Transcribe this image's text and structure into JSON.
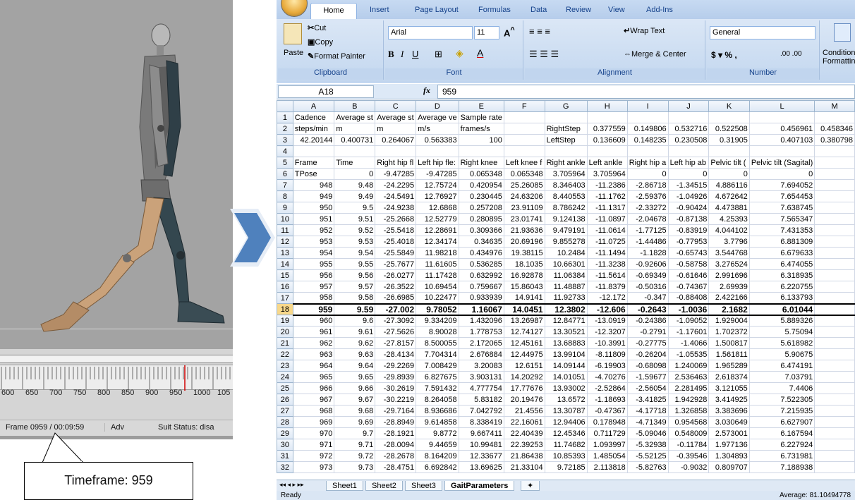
{
  "mocap": {
    "ruler_labels": [
      "600",
      "650",
      "700",
      "750",
      "800",
      "850",
      "900",
      "950",
      "1000",
      "105"
    ],
    "status_frame": "Frame 0959 / 00:09:59",
    "status_mode": "Adv",
    "status_suit": "Suit Status: disa",
    "callout": "Timeframe: 959",
    "current_frame": 959,
    "colors": {
      "body": "#caa27a",
      "dark": "#34474f",
      "grey": "#6f6f6f"
    }
  },
  "excel": {
    "tabs": [
      "Home",
      "Insert",
      "Page Layout",
      "Formulas",
      "Data",
      "Review",
      "View",
      "Add-Ins"
    ],
    "ribbon": {
      "clipboard": {
        "label": "Clipboard",
        "paste": "Paste",
        "cut": "Cut",
        "copy": "Copy",
        "format_painter": "Format Painter"
      },
      "font": {
        "label": "Font",
        "name": "Arial",
        "size": "11"
      },
      "alignment": {
        "label": "Alignment",
        "wrap": "Wrap Text",
        "merge": "Merge & Center"
      },
      "number": {
        "label": "Number",
        "format": "General"
      },
      "styles": {
        "conditional": "Conditional",
        "formatting": "Formatting"
      }
    },
    "name_box": "A18",
    "fx": "fx",
    "formula_value": "959",
    "columns": [
      "A",
      "B",
      "C",
      "D",
      "E",
      "F",
      "G",
      "H",
      "I",
      "J",
      "K",
      "L",
      "M"
    ],
    "rows": [
      {
        "n": "1",
        "c": [
          "Cadence",
          "Average st",
          "Average st",
          "Average ve",
          "Sample rate",
          "",
          "",
          "",
          "",
          "",
          "",
          "",
          ""
        ]
      },
      {
        "n": "2",
        "c": [
          "steps/min",
          "m",
          "m",
          "m/s",
          "frames/s",
          "",
          "RightStep",
          "0.377559",
          "0.149806",
          "0.532716",
          "0.522508",
          "0.456961",
          "0.458346"
        ]
      },
      {
        "n": "3",
        "c": [
          "42.20144",
          "0.400731",
          "0.264067",
          "0.563383",
          "100",
          "",
          "LeftStep",
          "0.136609",
          "0.148235",
          "0.230508",
          "0.31905",
          "0.407103",
          "0.380798"
        ]
      },
      {
        "n": "4",
        "c": [
          "",
          "",
          "",
          "",
          "",
          "",
          "",
          "",
          "",
          "",
          "",
          "",
          ""
        ]
      },
      {
        "n": "5",
        "c": [
          "Frame",
          "Time",
          "Right hip fl",
          "Left hip fle:",
          "Right knee",
          "Left knee f",
          "Right ankle",
          "Left ankle",
          "Right hip a",
          "Left hip ab",
          "Pelvic tilt (",
          "Pelvic tilt (Sagital)",
          ""
        ]
      },
      {
        "n": "6",
        "c": [
          "TPose",
          "0",
          "-9.47285",
          "-9.47285",
          "0.065348",
          "0.065348",
          "3.705964",
          "3.705964",
          "0",
          "0",
          "0",
          "0",
          ""
        ]
      },
      {
        "n": "7",
        "c": [
          "948",
          "9.48",
          "-24.2295",
          "12.75724",
          "0.420954",
          "25.26085",
          "8.346403",
          "-11.2386",
          "-2.86718",
          "-1.34515",
          "4.886116",
          "7.694052",
          ""
        ]
      },
      {
        "n": "8",
        "c": [
          "949",
          "9.49",
          "-24.5491",
          "12.76927",
          "0.230445",
          "24.63206",
          "8.440553",
          "-11.1762",
          "-2.59376",
          "-1.04926",
          "4.672642",
          "7.654453",
          ""
        ]
      },
      {
        "n": "9",
        "c": [
          "950",
          "9.5",
          "-24.9238",
          "12.6868",
          "0.257208",
          "23.91109",
          "8.786242",
          "-11.1317",
          "-2.33272",
          "-0.90424",
          "4.473881",
          "7.638745",
          ""
        ]
      },
      {
        "n": "10",
        "c": [
          "951",
          "9.51",
          "-25.2668",
          "12.52779",
          "0.280895",
          "23.01741",
          "9.124138",
          "-11.0897",
          "-2.04678",
          "-0.87138",
          "4.25393",
          "7.565347",
          ""
        ]
      },
      {
        "n": "11",
        "c": [
          "952",
          "9.52",
          "-25.5418",
          "12.28691",
          "0.309366",
          "21.93636",
          "9.479191",
          "-11.0614",
          "-1.77125",
          "-0.83919",
          "4.044102",
          "7.431353",
          ""
        ]
      },
      {
        "n": "12",
        "c": [
          "953",
          "9.53",
          "-25.4018",
          "12.34174",
          "0.34635",
          "20.69196",
          "9.855278",
          "-11.0725",
          "-1.44486",
          "-0.77953",
          "3.7796",
          "6.881309",
          ""
        ]
      },
      {
        "n": "13",
        "c": [
          "954",
          "9.54",
          "-25.5849",
          "11.98218",
          "0.434976",
          "19.38115",
          "10.2484",
          "-11.1494",
          "-1.1828",
          "-0.65743",
          "3.544768",
          "6.679633",
          ""
        ]
      },
      {
        "n": "14",
        "c": [
          "955",
          "9.55",
          "-25.7677",
          "11.61605",
          "0.536285",
          "18.1035",
          "10.66301",
          "-11.3238",
          "-0.92606",
          "-0.58758",
          "3.276524",
          "6.474055",
          ""
        ]
      },
      {
        "n": "15",
        "c": [
          "956",
          "9.56",
          "-26.0277",
          "11.17428",
          "0.632992",
          "16.92878",
          "11.06384",
          "-11.5614",
          "-0.69349",
          "-0.61646",
          "2.991696",
          "6.318935",
          ""
        ]
      },
      {
        "n": "16",
        "c": [
          "957",
          "9.57",
          "-26.3522",
          "10.69454",
          "0.759667",
          "15.86043",
          "11.48887",
          "-11.8379",
          "-0.50316",
          "-0.74367",
          "2.69939",
          "6.220755",
          ""
        ]
      },
      {
        "n": "17",
        "c": [
          "958",
          "9.58",
          "-26.6985",
          "10.22477",
          "0.933939",
          "14.9141",
          "11.92733",
          "-12.172",
          "-0.347",
          "-0.88408",
          "2.422166",
          "6.133793",
          ""
        ]
      },
      {
        "n": "18",
        "c": [
          "959",
          "9.59",
          "-27.002",
          "9.78052",
          "1.16067",
          "14.0451",
          "12.3802",
          "-12.606",
          "-0.2643",
          "-1.0036",
          "2.1682",
          "6.01044",
          ""
        ],
        "selected": true
      },
      {
        "n": "19",
        "c": [
          "960",
          "9.6",
          "-27.3092",
          "9.334209",
          "1.432096",
          "13.26987",
          "12.84771",
          "-13.0919",
          "-0.24386",
          "-1.09052",
          "1.929004",
          "5.889326",
          ""
        ]
      },
      {
        "n": "20",
        "c": [
          "961",
          "9.61",
          "-27.5626",
          "8.90028",
          "1.778753",
          "12.74127",
          "13.30521",
          "-12.3207",
          "-0.2791",
          "-1.17601",
          "1.702372",
          "5.75094",
          ""
        ]
      },
      {
        "n": "21",
        "c": [
          "962",
          "9.62",
          "-27.8157",
          "8.500055",
          "2.172065",
          "12.45161",
          "13.68883",
          "-10.3991",
          "-0.27775",
          "-1.4066",
          "1.500817",
          "5.618982",
          ""
        ]
      },
      {
        "n": "22",
        "c": [
          "963",
          "9.63",
          "-28.4134",
          "7.704314",
          "2.676884",
          "12.44975",
          "13.99104",
          "-8.11809",
          "-0.26204",
          "-1.05535",
          "1.561811",
          "5.90675",
          ""
        ]
      },
      {
        "n": "23",
        "c": [
          "964",
          "9.64",
          "-29.2269",
          "7.008429",
          "3.20083",
          "12.6151",
          "14.09144",
          "-6.19903",
          "-0.68098",
          "1.240069",
          "1.965289",
          "6.474191",
          ""
        ]
      },
      {
        "n": "24",
        "c": [
          "965",
          "9.65",
          "-29.8939",
          "6.827675",
          "3.903131",
          "14.20292",
          "14.01051",
          "-4.70276",
          "-1.59677",
          "2.536463",
          "2.618374",
          "7.03791",
          ""
        ]
      },
      {
        "n": "25",
        "c": [
          "966",
          "9.66",
          "-30.2619",
          "7.591432",
          "4.777754",
          "17.77676",
          "13.93002",
          "-2.52864",
          "-2.56054",
          "2.281495",
          "3.121055",
          "7.4406",
          ""
        ]
      },
      {
        "n": "26",
        "c": [
          "967",
          "9.67",
          "-30.2219",
          "8.264058",
          "5.83182",
          "20.19476",
          "13.6572",
          "-1.18693",
          "-3.41825",
          "1.942928",
          "3.414925",
          "7.522305",
          ""
        ]
      },
      {
        "n": "27",
        "c": [
          "968",
          "9.68",
          "-29.7164",
          "8.936686",
          "7.042792",
          "21.4556",
          "13.30787",
          "-0.47367",
          "-4.17718",
          "1.326858",
          "3.383696",
          "7.215935",
          ""
        ]
      },
      {
        "n": "28",
        "c": [
          "969",
          "9.69",
          "-28.8949",
          "9.614858",
          "8.338419",
          "22.16061",
          "12.94406",
          "0.178948",
          "-4.71349",
          "0.954568",
          "3.030649",
          "6.627907",
          ""
        ]
      },
      {
        "n": "29",
        "c": [
          "970",
          "9.7",
          "-28.1921",
          "9.8772",
          "9.667411",
          "22.40439",
          "12.45346",
          "0.711729",
          "-5.09046",
          "0.548009",
          "2.573001",
          "6.167594",
          ""
        ]
      },
      {
        "n": "30",
        "c": [
          "971",
          "9.71",
          "-28.0094",
          "9.44659",
          "10.99481",
          "22.39253",
          "11.74682",
          "1.093997",
          "-5.32938",
          "-0.11784",
          "1.977136",
          "6.227924",
          ""
        ]
      },
      {
        "n": "31",
        "c": [
          "972",
          "9.72",
          "-28.2678",
          "8.164209",
          "12.33677",
          "21.86438",
          "10.85393",
          "1.485054",
          "-5.52125",
          "-0.39546",
          "1.304893",
          "6.731981",
          ""
        ]
      },
      {
        "n": "32",
        "c": [
          "973",
          "9.73",
          "-28.4751",
          "6.692842",
          "13.69625",
          "21.33104",
          "9.72185",
          "2.113818",
          "-5.82763",
          "-0.9032",
          "0.809707",
          "7.188938",
          ""
        ]
      }
    ],
    "sheet_tabs": [
      "Sheet1",
      "Sheet2",
      "Sheet3",
      "GaitParameters"
    ],
    "active_sheet": "GaitParameters",
    "status_ready": "Ready",
    "status_average": "Average: 81.10494778"
  }
}
